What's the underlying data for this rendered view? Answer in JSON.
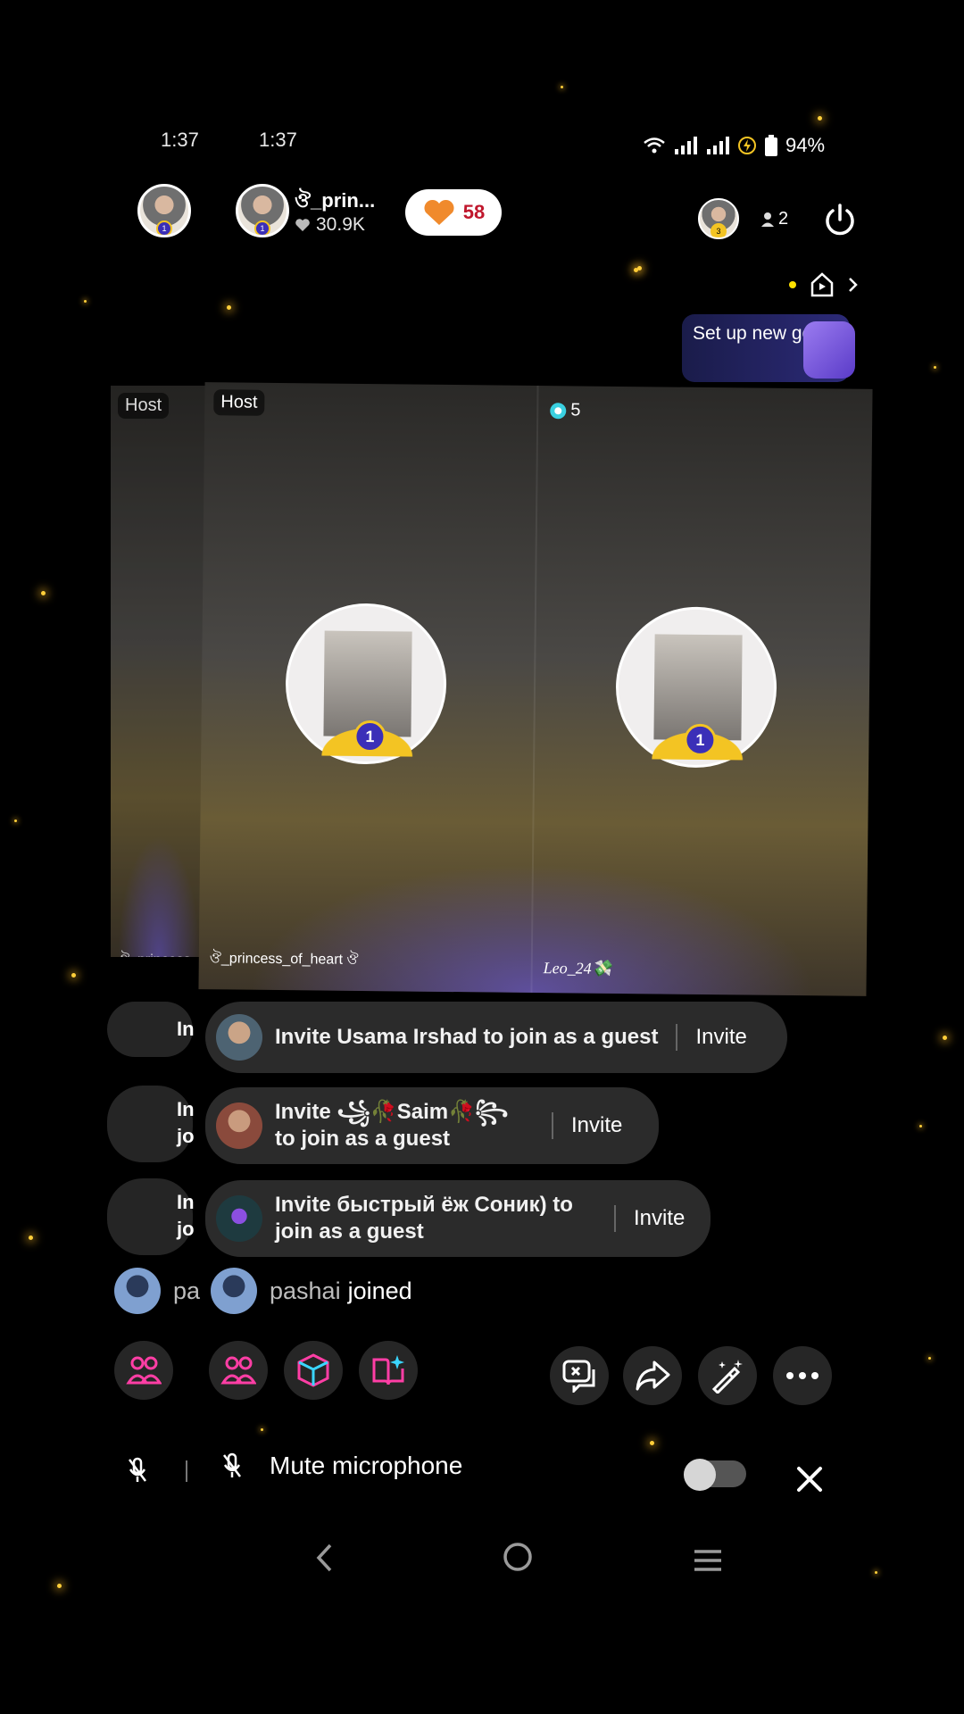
{
  "status_bar": {
    "time_back": "1:37",
    "time_front": "1:37",
    "battery": "94%"
  },
  "header": {
    "host_name": "ঔ_prin...",
    "host_likes": "30.9K",
    "like_count": "58",
    "viewer_count": "2",
    "viewer_badge": "3",
    "host_badge": "1"
  },
  "goal": {
    "label": "Set up new goal"
  },
  "stage": {
    "host_label_back": "Host",
    "host_label_front": "Host",
    "coin_count": "5",
    "host_pane_name_back": "ঔ_princess",
    "host_pane_name": "ঔ_princess_of_heart ঔ",
    "guest_pane_name": "Leo_24💸",
    "avatar_badge": "1"
  },
  "invites": [
    {
      "text": "Invite Usama Irshad to join as a guest",
      "button": "Invite"
    },
    {
      "text": "Invite ꧁🥀Saim🥀꧂ to join as a guest",
      "button": "Invite"
    },
    {
      "text": "Invite быстрый ёж Соник) to join as a guest",
      "button": "Invite"
    }
  ],
  "back_toast_labels": [
    "In",
    "In jo",
    "In jo"
  ],
  "joined": {
    "name": "pashai",
    "back_name": "pa",
    "suffix": "joined"
  },
  "bottom": {
    "mute_label": "Mute microphone"
  },
  "colors": {
    "accent_pink": "#ff3ea5",
    "like_red": "#c0172d",
    "star_gold": "#ffcf3a"
  }
}
